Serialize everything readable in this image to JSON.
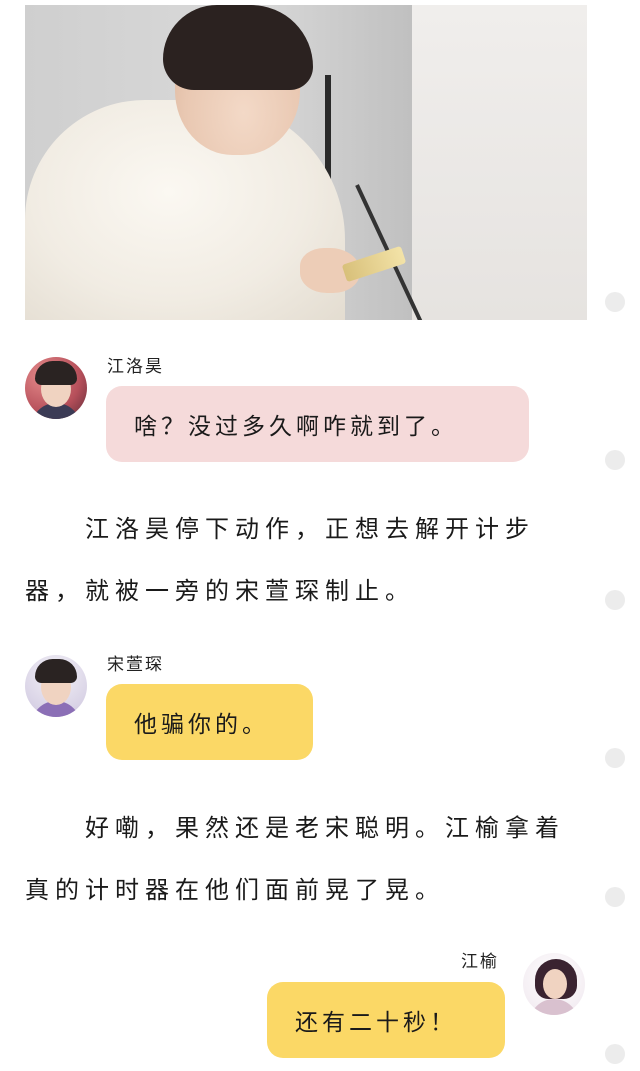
{
  "messages": [
    {
      "sender": "江洛昊",
      "text": "啥？没过多久啊咋就到了。",
      "bubble_color": "#f5dada",
      "side": "left"
    },
    {
      "sender": "宋萱琛",
      "text": "他骗你的。",
      "bubble_color": "#fbd866",
      "side": "left"
    },
    {
      "sender": "江榆",
      "text": "还有二十秒！",
      "bubble_color": "#fbd866",
      "side": "right"
    }
  ],
  "narration": [
    {
      "lines": [
        "　　江洛昊停下动作，正想去解开计步",
        "器，就被一旁的宋萱琛制止。"
      ]
    },
    {
      "lines": [
        "　　好嘞，果然还是老宋聪明。江榆拿着",
        "真的计时器在他们面前晃了晃。"
      ]
    }
  ],
  "colors": {
    "background": "#ffffff",
    "pink_bubble": "#f5dada",
    "yellow_bubble": "#fbd866",
    "side_dot": "#ececec"
  },
  "icons": {
    "photo": "studio-photo-boy-with-phone",
    "avatars": [
      "avatar-jiang-luohao",
      "avatar-song-xuanchen",
      "avatar-jiang-yu"
    ]
  }
}
